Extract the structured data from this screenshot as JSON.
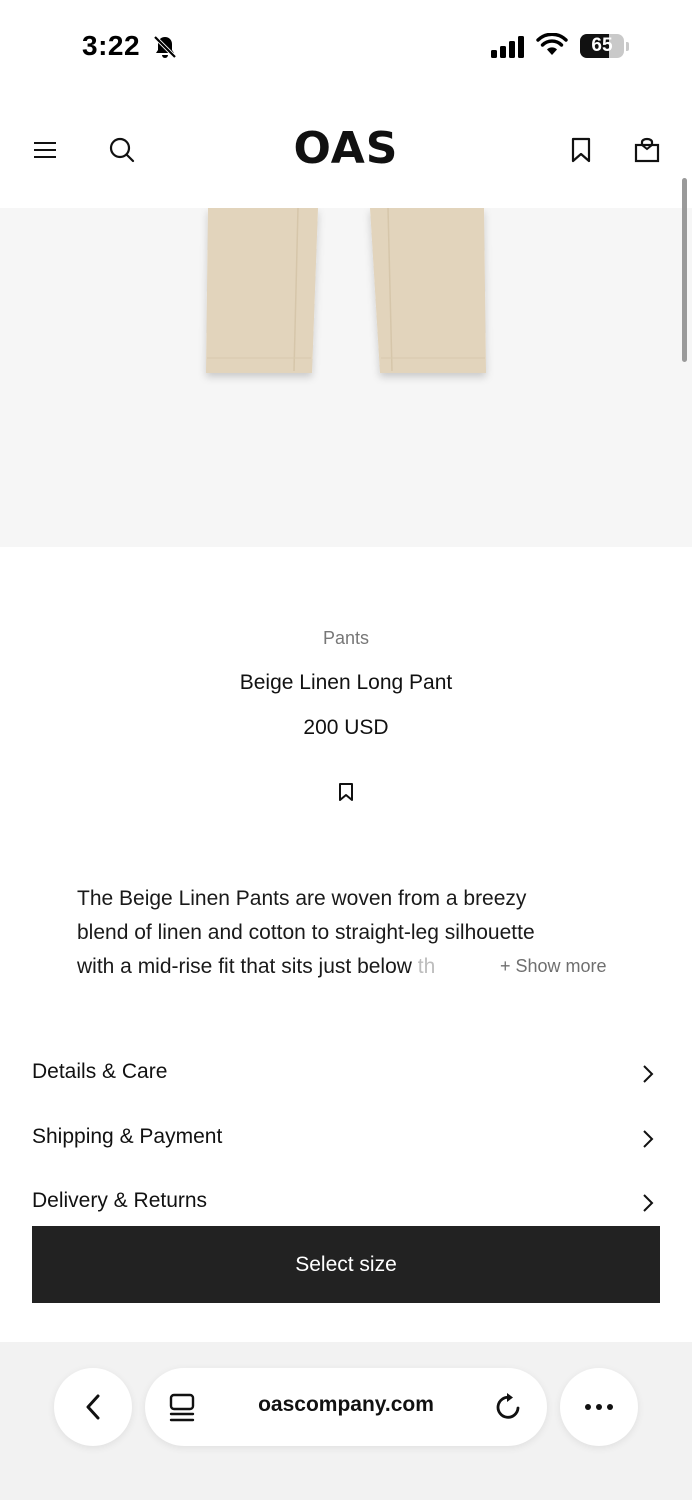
{
  "status_bar": {
    "time": "3:22",
    "battery_level": "65",
    "battery_fraction": 0.65
  },
  "header": {
    "logo": "OAS",
    "icons": [
      "menu-icon",
      "search-icon",
      "bookmark-icon",
      "bag-icon"
    ]
  },
  "product": {
    "category": "Pants",
    "name": "Beige Linen Long Pant",
    "price": "200 USD",
    "description_lines": [
      "The Beige Linen Pants are woven from a breezy",
      "blend of linen and cotton to straight-leg silhouette",
      "with a mid-rise fit that sits just below",
      "th"
    ],
    "show_more": "+ Show more"
  },
  "accordion": [
    {
      "label": "Details & Care"
    },
    {
      "label": "Shipping & Payment"
    },
    {
      "label": "Delivery & Returns"
    }
  ],
  "cta": {
    "select_size": "Select size"
  },
  "browser": {
    "url": "oascompany.com"
  },
  "colors": {
    "button_bg": "#222222",
    "image_bg": "#f6f6f6",
    "pant": "#e2d4bc",
    "muted_text": "#777777"
  }
}
